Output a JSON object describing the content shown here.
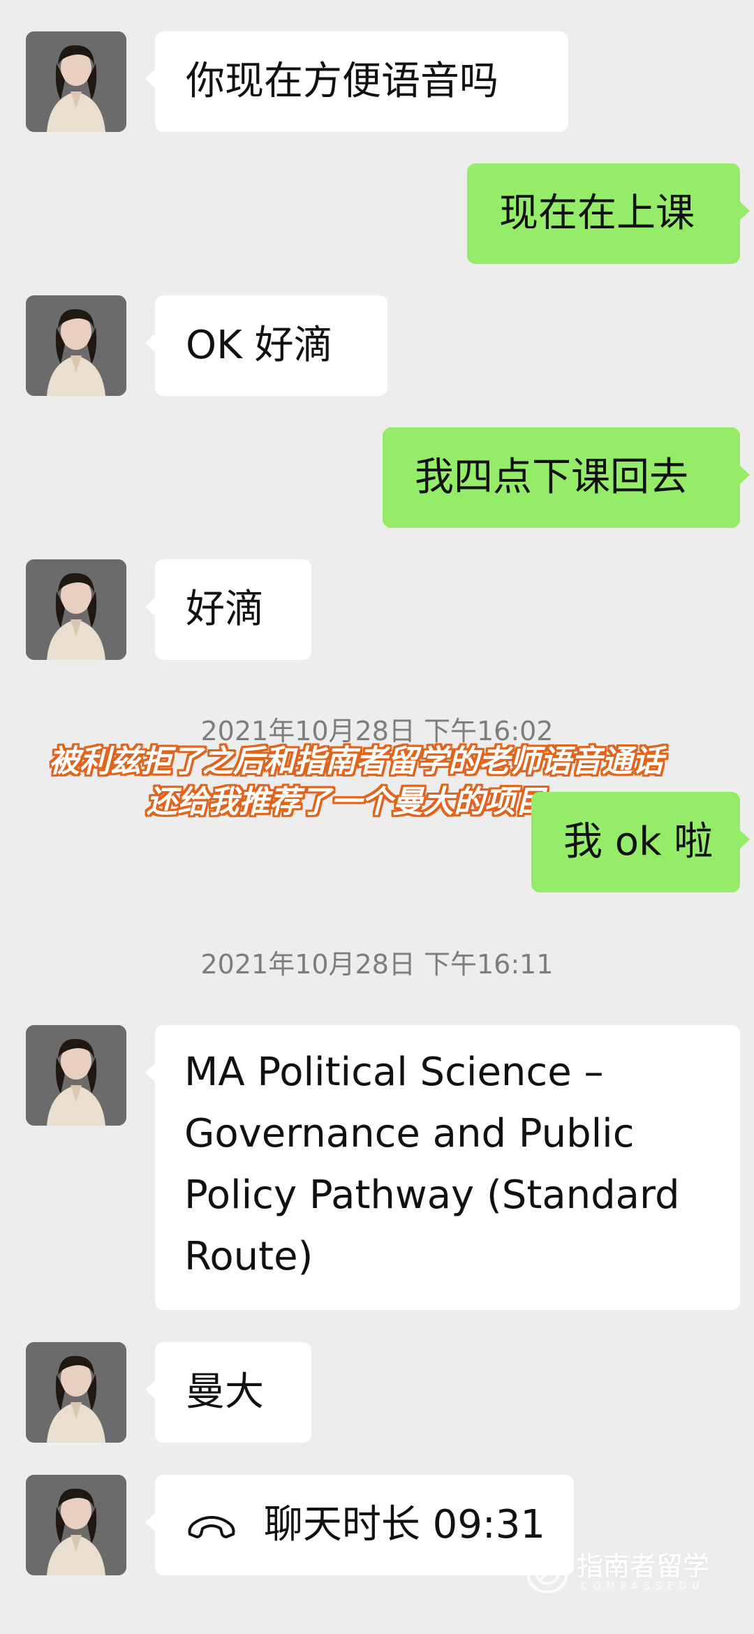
{
  "messages": [
    {
      "type": "in",
      "text": "你现在方便语音吗"
    },
    {
      "type": "out",
      "text": "现在在上课"
    },
    {
      "type": "in",
      "text": "OK 好滴"
    },
    {
      "type": "out",
      "text": "我四点下课回去"
    },
    {
      "type": "in",
      "text": "好滴"
    },
    {
      "type": "out",
      "text": "我 ok 啦"
    },
    {
      "type": "in",
      "text": "MA Political Science – Governance and Public Policy Pathway (Standard Route)"
    },
    {
      "type": "in",
      "text": "曼大"
    },
    {
      "type": "in",
      "call_label": "聊天时长 09:31",
      "icon": "phone-hangup-icon"
    }
  ],
  "timestamps": [
    "2021年10月28日 下午16:02",
    "2021年10月28日 下午16:11"
  ],
  "subtitle": {
    "line1": "被利兹拒了之后和指南者留学的老师语音通话",
    "line2": "还给我推荐了一个曼大的项目"
  },
  "watermark": {
    "text": "指南者留学",
    "sub": "COMPASSEDU"
  },
  "colors": {
    "background": "#ededed",
    "incoming_bubble": "#ffffff",
    "outgoing_bubble": "#95ec69",
    "subtitle_outline": "#e0641c",
    "timestamp_text": "#7d7d7d"
  }
}
